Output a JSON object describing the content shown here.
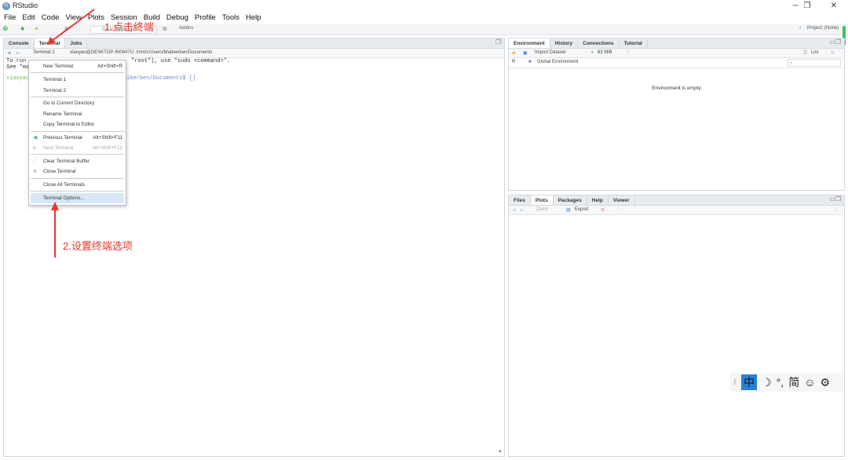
{
  "window": {
    "title": "RStudio",
    "icon": "R"
  },
  "menubar": [
    "File",
    "Edit",
    "Code",
    "View",
    "Plots",
    "Session",
    "Build",
    "Debug",
    "Profile",
    "Tools",
    "Help"
  ],
  "toolbar": {
    "goto": "Go to file/function",
    "addins": "Addins",
    "project": "Project: (None)"
  },
  "left_pane": {
    "tabs": [
      "Console",
      "Terminal",
      "Jobs"
    ],
    "active_tab": "Terminal",
    "terminal_select": "Terminal 2",
    "path": "xiaoyao@DESKTOP-IN0947U: /mnt/c/Users/Maibenben/Documents",
    "lines": [
      "To run",
      "\"root\"), use \"sudo <command>\".",
      "See \"ma",
      "xiaoyao",
      "iberben/Documents$ []"
    ]
  },
  "terminal_menu": {
    "items": [
      {
        "label": "New Terminal",
        "shortcut": "Alt+Shift+R"
      },
      {
        "label": "Terminal 1"
      },
      {
        "label": "Terminal 2"
      },
      {
        "label": "Go to Current Directory"
      },
      {
        "label": "Rename Terminal"
      },
      {
        "label": "Copy Terminal to Editor"
      },
      {
        "label": "Previous Terminal",
        "shortcut": "Alt+Shift+F11"
      },
      {
        "label": "Next Terminal",
        "shortcut": "Alt+Shift+F12"
      },
      {
        "label": "Clear Terminal Buffer"
      },
      {
        "label": "Close Terminal"
      },
      {
        "label": "Close All Terminals"
      },
      {
        "label": "Terminal Options..."
      }
    ],
    "highlighted": "Terminal Options..."
  },
  "annotations": {
    "step1": "1.点击终端",
    "step2": "2.设置终端选项",
    "color": "#e8342c"
  },
  "env_pane": {
    "tabs": [
      "Environment",
      "History",
      "Connections",
      "Tutorial"
    ],
    "import": "Import Dataset",
    "memory": "83 MiB",
    "view": "List",
    "lang": "R",
    "scope": "Global Environment",
    "empty": "Environment is empty"
  },
  "files_pane": {
    "tabs": [
      "Files",
      "Plots",
      "Packages",
      "Help",
      "Viewer"
    ],
    "active_tab": "Plots",
    "zoom": "Zoom",
    "export": "Export"
  },
  "ime": [
    "中",
    "☽",
    "°,",
    "简",
    "☺",
    "⚙"
  ]
}
